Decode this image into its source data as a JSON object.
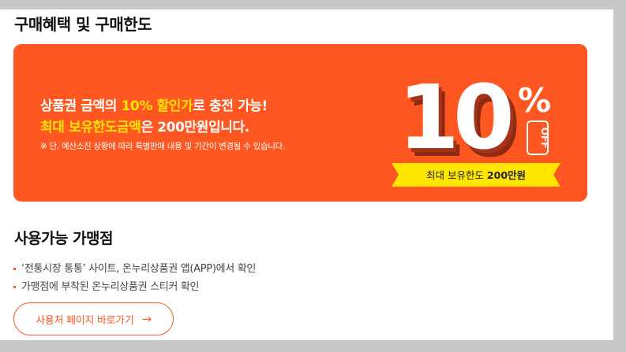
{
  "section1": {
    "title": "구매혜택 및 구매한도",
    "banner": {
      "line1_pre": "상품권 금액의 ",
      "line1_highlight": "10% 할인가",
      "line1_post": "로 충전 가능!",
      "line2_highlight": "최대 보유한도금액",
      "line2_post": "은 200만원입니다.",
      "note": "※ 단, 예산소진 상황에 따라 특별판매 내용 및 기간이 변경될 수 있습니다.",
      "badge_number": "10",
      "badge_percent": "%",
      "badge_off": "OFF",
      "ribbon_label": "최대 보유한도 ",
      "ribbon_amount": "200만원",
      "colors": {
        "background": "#ff5722",
        "highlight": "#ffe600",
        "ribbon": "#ffe600"
      }
    }
  },
  "section2": {
    "title": "사용가능 가맹점",
    "bullets": [
      "‘전통시장 통통’ 사이트, 온누리상품권 앱(APP)에서 확인",
      "가맹점에 부착된 온누리상품권 스티커 확인"
    ],
    "button_label": "사용처 페이지 바로가기",
    "button_icon": "arrow-right-icon"
  }
}
